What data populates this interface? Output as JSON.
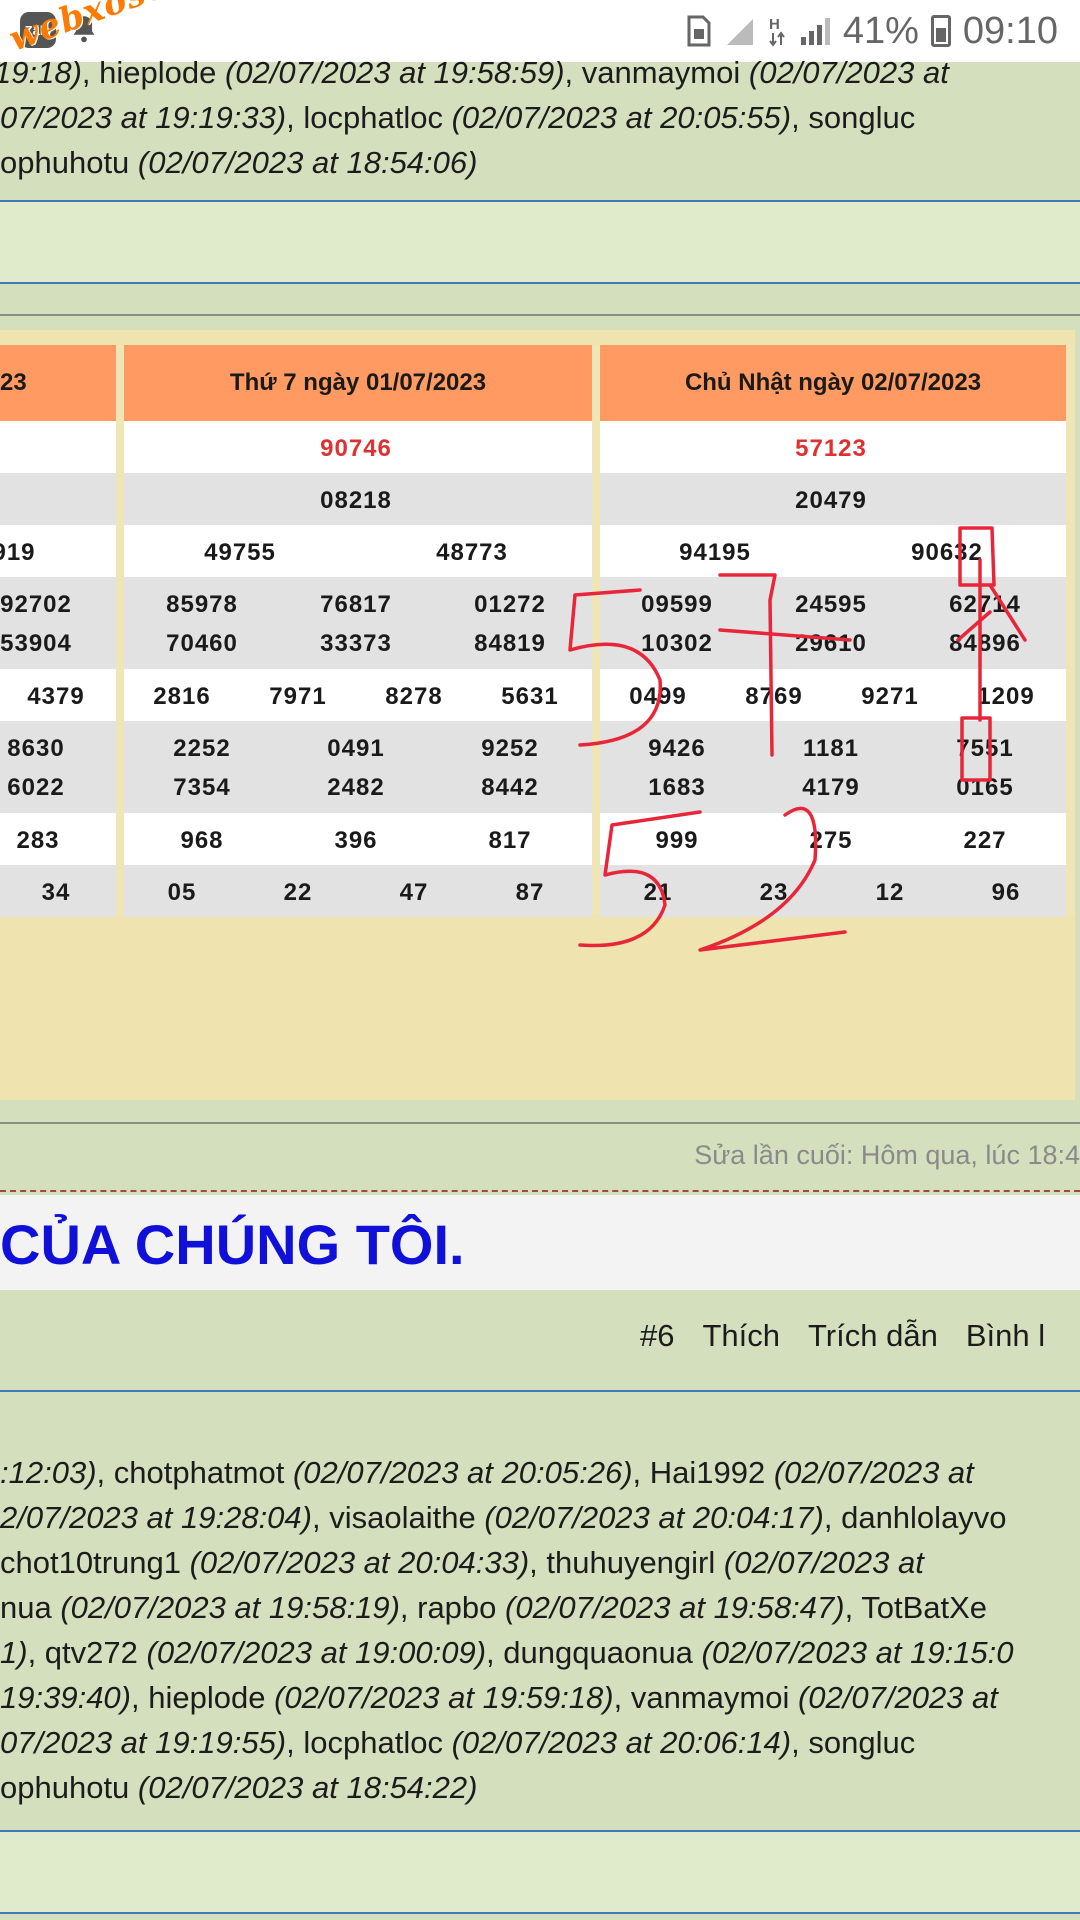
{
  "status_bar": {
    "zalo_label": "Zalo",
    "battery": "41%",
    "time": "09:10",
    "watermark": "webxoso.net"
  },
  "thanks_top": {
    "lines": [
      [
        "19:",
        "",
        "18)",
        ", hieplode ",
        "(02/07/2023 at 19:58:59)",
        ", vanmaymoi ",
        "(02/07/2023 at"
      ],
      [
        "",
        "",
        "07/2023 at 19:19:33)",
        ", locphatloc ",
        "(02/07/2023 at 20:05:55)",
        ", songluc",
        ""
      ],
      [
        "",
        "ophuhotu ",
        "(02/07/2023 at 18:54:06)",
        "",
        "",
        "",
        ""
      ]
    ]
  },
  "table": {
    "partial_head": "23",
    "columns": [
      {
        "heading": "Thứ 7 ngày 01/07/2023",
        "special": "90746",
        "first": "08218",
        "second": [
          "49755",
          "48773"
        ],
        "third_a": [
          "85978",
          "76817",
          "01272"
        ],
        "third_b": [
          "70460",
          "33373",
          "84819"
        ],
        "fourth": [
          "2816",
          "7971",
          "8278",
          "5631"
        ],
        "fifth_a": [
          "2252",
          "0491",
          "9252"
        ],
        "fifth_b": [
          "7354",
          "2482",
          "8442"
        ],
        "sixth": [
          "968",
          "396",
          "817"
        ],
        "seventh": [
          "05",
          "22",
          "47",
          "87"
        ]
      },
      {
        "heading": "Chủ Nhật ngày 02/07/2023",
        "special": "57123",
        "first": "20479",
        "second": [
          "94195",
          "90632"
        ],
        "third_a": [
          "09599",
          "24595",
          "62714"
        ],
        "third_b": [
          "10302",
          "29610",
          "84896"
        ],
        "fourth": [
          "0499",
          "8769",
          "9271",
          "1209"
        ],
        "fifth_a": [
          "9426",
          "1181",
          "7551"
        ],
        "fifth_b": [
          "1683",
          "4179",
          "0165"
        ],
        "sixth": [
          "999",
          "275",
          "227"
        ],
        "seventh": [
          "21",
          "23",
          "12",
          "96"
        ]
      }
    ],
    "partial_column": {
      "second": "919",
      "third_a": "92702",
      "third_b": "53904",
      "fourth": "4379",
      "fifth_a": "8630",
      "fifth_b": "6022",
      "sixth": "283",
      "seventh": "34"
    }
  },
  "handwriting": {
    "mark_1": "57",
    "mark_2": "52",
    "mark_3": "8",
    "color": "#e8263a"
  },
  "edit_note": "Sửa lần cuối: Hôm qua, lúc 18:4",
  "headline": "CỦA CHÚNG TÔI.",
  "post_actions": {
    "number": "#6",
    "like": "Thích",
    "quote": "Trích dẫn",
    "comment": "Bình l"
  },
  "thanks_bottom": {
    "lines": [
      [
        ":12:03)",
        ", chotphatmot ",
        "(02/07/2023 at 20:05:26)",
        ", Hai1992 ",
        "(02/07/2023 at"
      ],
      [
        "2/07/2023 at 19:28:04)",
        ", visaolaithe ",
        "(02/07/2023 at 20:04:17)",
        ", danhlolayvo",
        ""
      ],
      [
        "",
        "chot10trung1 ",
        "(02/07/2023 at 20:04:33)",
        ", thuhuyengirl ",
        "(02/07/2023 at"
      ],
      [
        "",
        "nua ",
        "(02/07/2023 at 19:58:19)",
        ", rapbo ",
        "(02/07/2023 at 19:58:47)",
        ", TotBatXe"
      ],
      [
        "1)",
        ", qtv272 ",
        "(02/07/2023 at 19:00:09)",
        ", dungquaonua ",
        "(02/07/2023 at 19:15:0"
      ],
      [
        "19:39:40)",
        ", hieplode ",
        "(02/07/2023 at 19:59:18)",
        ", vanmaymoi ",
        "(02/07/2023 at"
      ],
      [
        "07/2023 at 19:19:55)",
        ", locphatloc ",
        "(02/07/2023 at 20:06:14)",
        ", songluc",
        ""
      ],
      [
        "",
        "ophuhotu ",
        "(02/07/2023 at 18:54:22)",
        "",
        ""
      ]
    ]
  },
  "colors": {
    "page_bg": "#d4dfbe",
    "header_orange": "#ff9a62",
    "special_red": "#e03030",
    "headline_blue": "#1010d8",
    "divider_blue": "#3d7ab8"
  }
}
